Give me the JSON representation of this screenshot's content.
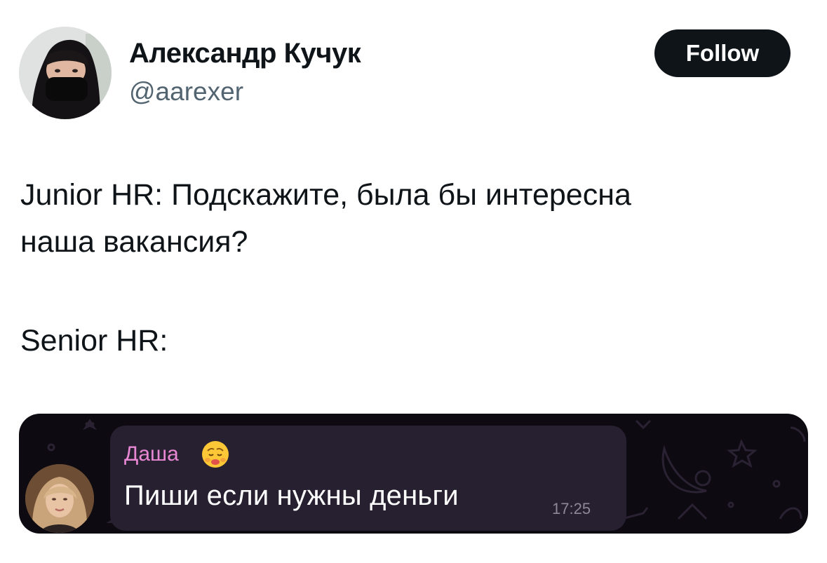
{
  "author": {
    "name": "Александр Кучук",
    "handle": "@aarexer"
  },
  "follow_label": "Follow",
  "tweet": {
    "lines": [
      "Junior HR: Подскажите, была бы интересна",
      "наша вакансия?",
      "Senior HR:"
    ]
  },
  "attached_chat": {
    "sender_name": "Даша",
    "sender_emoji_icon": "pleading-face-icon",
    "message": "Пиши если нужны деньги",
    "time": "17:25",
    "colors": {
      "background": "#0d0a12",
      "bubble": "#272030",
      "sender_name": "#e887d3",
      "time": "#8e8797"
    }
  },
  "colors": {
    "text": "#0f1419",
    "handle": "#536471",
    "follow_bg": "#0f1419",
    "follow_text": "#ffffff"
  }
}
